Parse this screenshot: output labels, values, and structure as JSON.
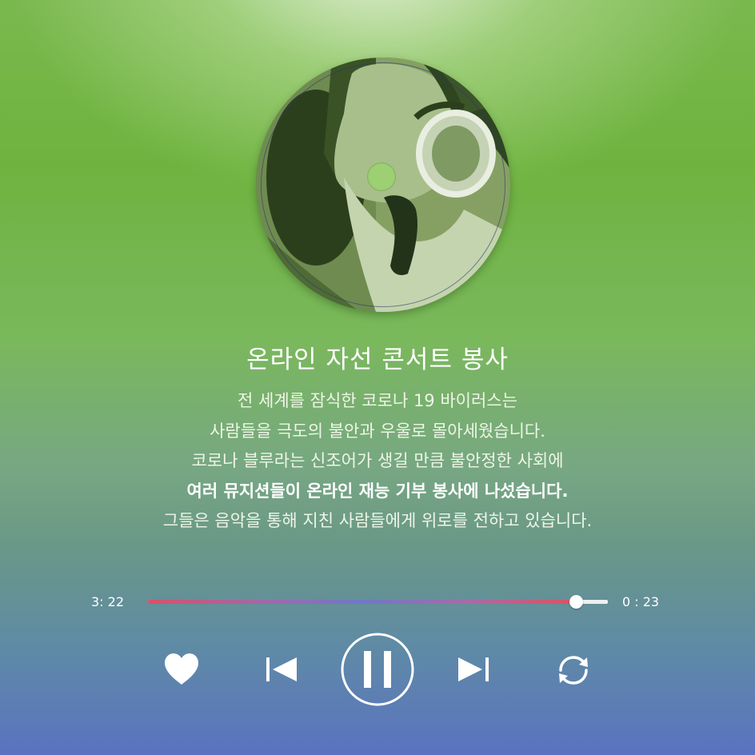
{
  "album": {
    "image_name": "singer-with-headphones-disc",
    "tint_color": "#4a6a2e"
  },
  "track": {
    "title": "온라인 자선 콘서트 봉사",
    "description": [
      "전 세계를 잠식한 코로나 19 바이러스는",
      "사람들을 극도의 불안과 우울로 몰아세웠습니다.",
      "코로나 블루라는 신조어가 생길 만큼 불안정한 사회에",
      "여러 뮤지션들이 온라인 재능 기부 봉사에 나섰습니다.",
      "그들은 음악을 통해 지친 사람들에게 위로를 전하고 있습니다."
    ],
    "bold_line_index": 3
  },
  "player": {
    "elapsed": "3: 22",
    "remaining": "0 : 23",
    "progress_fraction": 0.93,
    "state": "playing"
  },
  "controls": [
    {
      "name": "like-button",
      "icon": "heart-icon"
    },
    {
      "name": "previous-button",
      "icon": "skip-previous-icon"
    },
    {
      "name": "pause-button",
      "icon": "pause-icon"
    },
    {
      "name": "next-button",
      "icon": "skip-next-icon"
    },
    {
      "name": "repeat-button",
      "icon": "repeat-icon"
    }
  ],
  "colors": {
    "background_top": "#6fb33f",
    "background_bottom": "#5a72c1",
    "progress_start": "#d9506a",
    "progress_mid": "#6e78c8",
    "progress_end": "#e05060",
    "icon": "#ffffff"
  }
}
